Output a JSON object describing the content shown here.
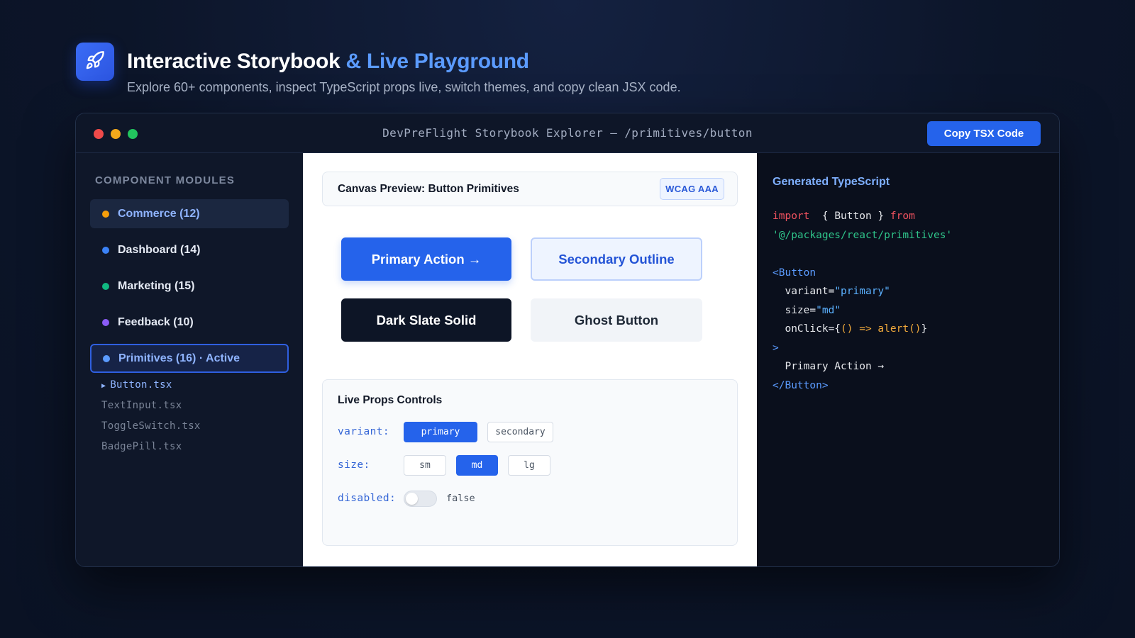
{
  "header": {
    "title_main": "Interactive Storybook",
    "title_accent": "& Live Playground",
    "subtitle": "Explore 60+ components, inspect TypeScript props live, switch themes, and copy clean JSX code.",
    "logo_icon": "rocket-icon"
  },
  "window": {
    "title": "DevPreFlight Storybook Explorer — /primitives/button",
    "copy_button": "Copy TSX Code"
  },
  "sidebar": {
    "heading": "COMPONENT MODULES",
    "modules": [
      {
        "label": "Commerce (12)",
        "color": "#f59e0b",
        "state": "hover"
      },
      {
        "label": "Dashboard (14)",
        "color": "#3b82f6",
        "state": "normal"
      },
      {
        "label": "Marketing (15)",
        "color": "#10b981",
        "state": "normal"
      },
      {
        "label": "Feedback (10)",
        "color": "#8b5cf6",
        "state": "normal"
      },
      {
        "label": "Primitives (16) · Active",
        "color": "#5b9bff",
        "state": "active"
      }
    ],
    "files": [
      {
        "label": "Button.tsx",
        "selected": true
      },
      {
        "label": "TextInput.tsx",
        "selected": false
      },
      {
        "label": "ToggleSwitch.tsx",
        "selected": false
      },
      {
        "label": "BadgePill.tsx",
        "selected": false
      }
    ]
  },
  "canvas": {
    "preview_title": "Canvas Preview: Button Primitives",
    "badge": "WCAG AAA",
    "buttons": {
      "primary": "Primary Action →",
      "secondary": "Secondary Outline",
      "dark": "Dark Slate Solid",
      "ghost": "Ghost Button"
    }
  },
  "props": {
    "title": "Live Props Controls",
    "variant_label": "variant:",
    "variant_options": [
      "primary",
      "secondary"
    ],
    "variant_selected": "primary",
    "size_label": "size:",
    "size_options": [
      "sm",
      "md",
      "lg"
    ],
    "size_selected": "md",
    "disabled_label": "disabled:",
    "disabled_value": "false"
  },
  "code": {
    "title": "Generated TypeScript",
    "import_kw": "import",
    "import_body": "{ Button }",
    "from_kw": "from",
    "module_path": "'@/packages/react/primitives'",
    "open_tag": "<Button",
    "attr_variant": "variant=",
    "val_variant": "\"primary\"",
    "attr_size": "size=",
    "val_size": "\"md\"",
    "attr_onclick": "onClick={",
    "val_onclick": "() => alert()",
    "onclick_close": "}",
    "close_bracket": ">",
    "children": "Primary Action →",
    "close_tag": "</Button>"
  },
  "colors": {
    "accent": "#2563eb",
    "accent_light": "#5b9bff",
    "background": "#0c1529"
  }
}
